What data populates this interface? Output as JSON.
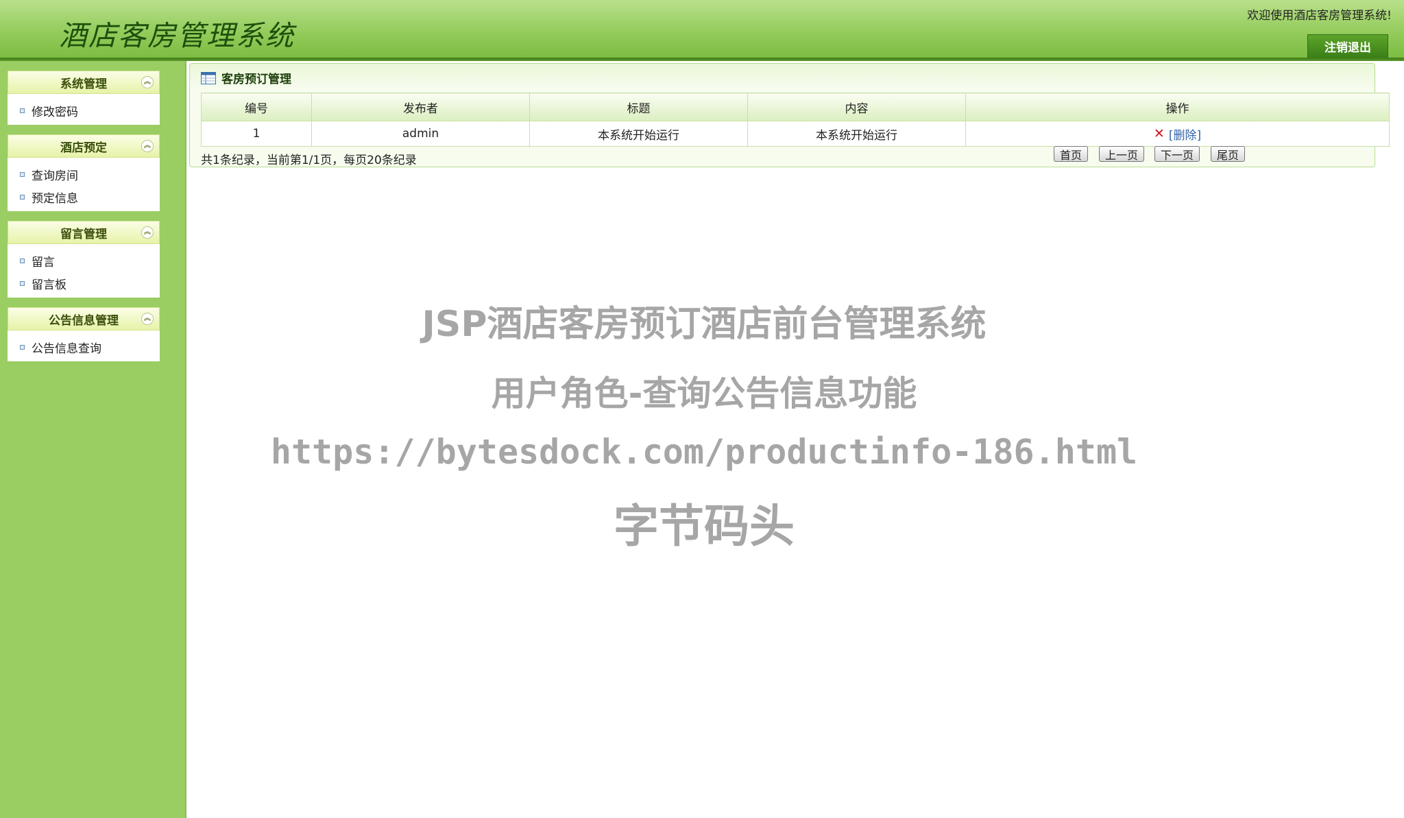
{
  "header": {
    "title": "酒店客房管理系统",
    "welcome": "欢迎使用酒店客房管理系统!",
    "logout_label": "注销退出"
  },
  "sidebar": {
    "groups": [
      {
        "title": "系统管理",
        "items": [
          "修改密码"
        ]
      },
      {
        "title": "酒店预定",
        "items": [
          "查询房间",
          "预定信息"
        ]
      },
      {
        "title": "留言管理",
        "items": [
          "留言",
          "留言板"
        ]
      },
      {
        "title": "公告信息管理",
        "items": [
          "公告信息查询"
        ]
      }
    ]
  },
  "main": {
    "panel_title": "客房预订管理",
    "columns": [
      "编号",
      "发布者",
      "标题",
      "内容",
      "操作"
    ],
    "rows": [
      {
        "id": "1",
        "publisher": "admin",
        "title": "本系统开始运行",
        "content": "本系统开始运行",
        "action": "[删除]"
      }
    ],
    "pager": {
      "info": "共1条纪录，当前第1/1页，每页20条纪录",
      "first": "首页",
      "prev": "上一页",
      "next": "下一页",
      "last": "尾页"
    }
  },
  "watermark": {
    "line1": "JSP酒店客房预订酒店前台管理系统",
    "line2": "用户角色-查询公告信息功能",
    "line3": "https://bytesdock.com/productinfo-186.html",
    "line4": "字节码头"
  },
  "colors": {
    "header_green": "#94cc5c",
    "sidebar_green": "#9acd62",
    "logout_green": "#3a7f17",
    "delete_red": "#c8141e",
    "link_blue": "#3063a8"
  },
  "icons": {
    "collapse": "double-chevron-up-icon",
    "bullet": "square-bullet-icon",
    "table": "table-icon",
    "delete": "x-icon"
  }
}
